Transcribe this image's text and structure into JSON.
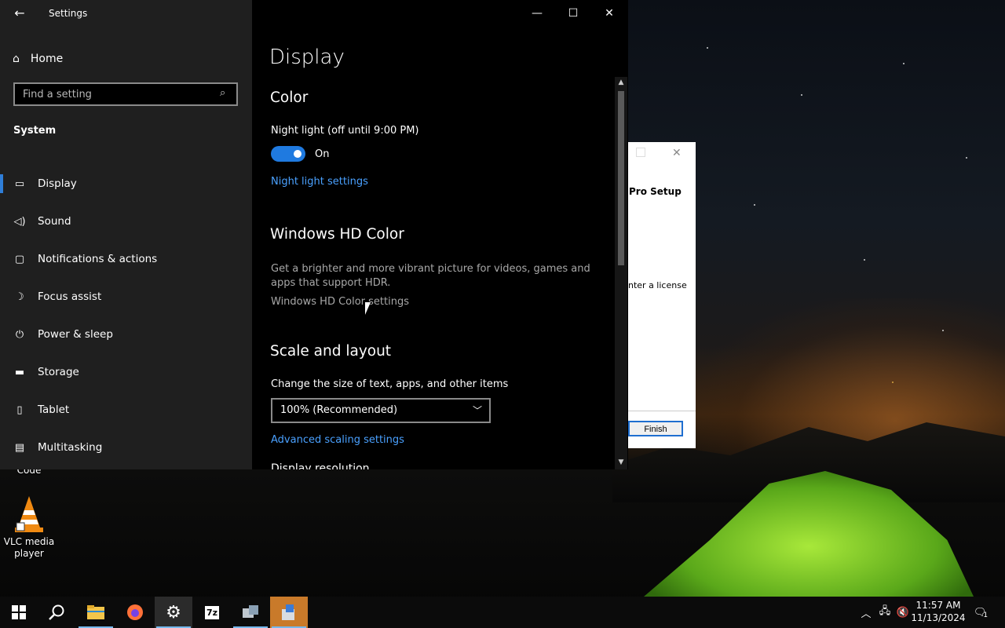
{
  "window": {
    "title": "Settings",
    "controls": {
      "minimize": "—",
      "maximize": "☐",
      "close": "✕"
    }
  },
  "sidebar": {
    "home": "Home",
    "search_placeholder": "Find a setting",
    "section": "System",
    "items": [
      {
        "label": "Display",
        "icon": "monitor-icon",
        "glyph": "▭",
        "active": true
      },
      {
        "label": "Sound",
        "icon": "speaker-icon",
        "glyph": "🔈"
      },
      {
        "label": "Notifications & actions",
        "icon": "notification-icon",
        "glyph": "▢"
      },
      {
        "label": "Focus assist",
        "icon": "moon-icon",
        "glyph": "☽"
      },
      {
        "label": "Power & sleep",
        "icon": "power-icon",
        "glyph": "⏻"
      },
      {
        "label": "Storage",
        "icon": "storage-icon",
        "glyph": "▬"
      },
      {
        "label": "Tablet",
        "icon": "tablet-icon",
        "glyph": "▯"
      },
      {
        "label": "Multitasking",
        "icon": "multitasking-icon",
        "glyph": "▤"
      }
    ]
  },
  "content": {
    "page_title": "Display",
    "color": {
      "heading": "Color",
      "night_light_label": "Night light (off until 9:00 PM)",
      "toggle_state": "On",
      "night_light_link": "Night light settings"
    },
    "hd_color": {
      "heading": "Windows HD Color",
      "description": "Get a brighter and more vibrant picture for videos, games and apps that support HDR.",
      "link": "Windows HD Color settings"
    },
    "scale": {
      "heading": "Scale and layout",
      "label": "Change the size of text, apps, and other items",
      "selected": "100% (Recommended)",
      "link": "Advanced scaling settings",
      "next_heading_clipped": "Display resolution"
    }
  },
  "dialog": {
    "title": "Pro Setup",
    "text": "nter a license",
    "finish": "Finish"
  },
  "desktop": {
    "icons": [
      {
        "label": "Code",
        "icon": "vscode-icon"
      },
      {
        "label": "VLC media player",
        "icon": "vlc-icon"
      }
    ]
  },
  "taskbar": {
    "apps": [
      {
        "name": "start-button",
        "icon": "windows-icon"
      },
      {
        "name": "search-button",
        "icon": "search-icon"
      },
      {
        "name": "file-explorer",
        "icon": "folder-icon"
      },
      {
        "name": "firefox",
        "icon": "firefox-icon"
      },
      {
        "name": "settings",
        "icon": "gear-icon"
      },
      {
        "name": "7zip",
        "icon": "7zip-icon",
        "text": "7z"
      },
      {
        "name": "network-app",
        "icon": "computer-icon"
      },
      {
        "name": "installer",
        "icon": "installer-icon"
      }
    ],
    "clock_time": "11:57 AM",
    "clock_date": "11/13/2024",
    "notification_count": "1"
  }
}
